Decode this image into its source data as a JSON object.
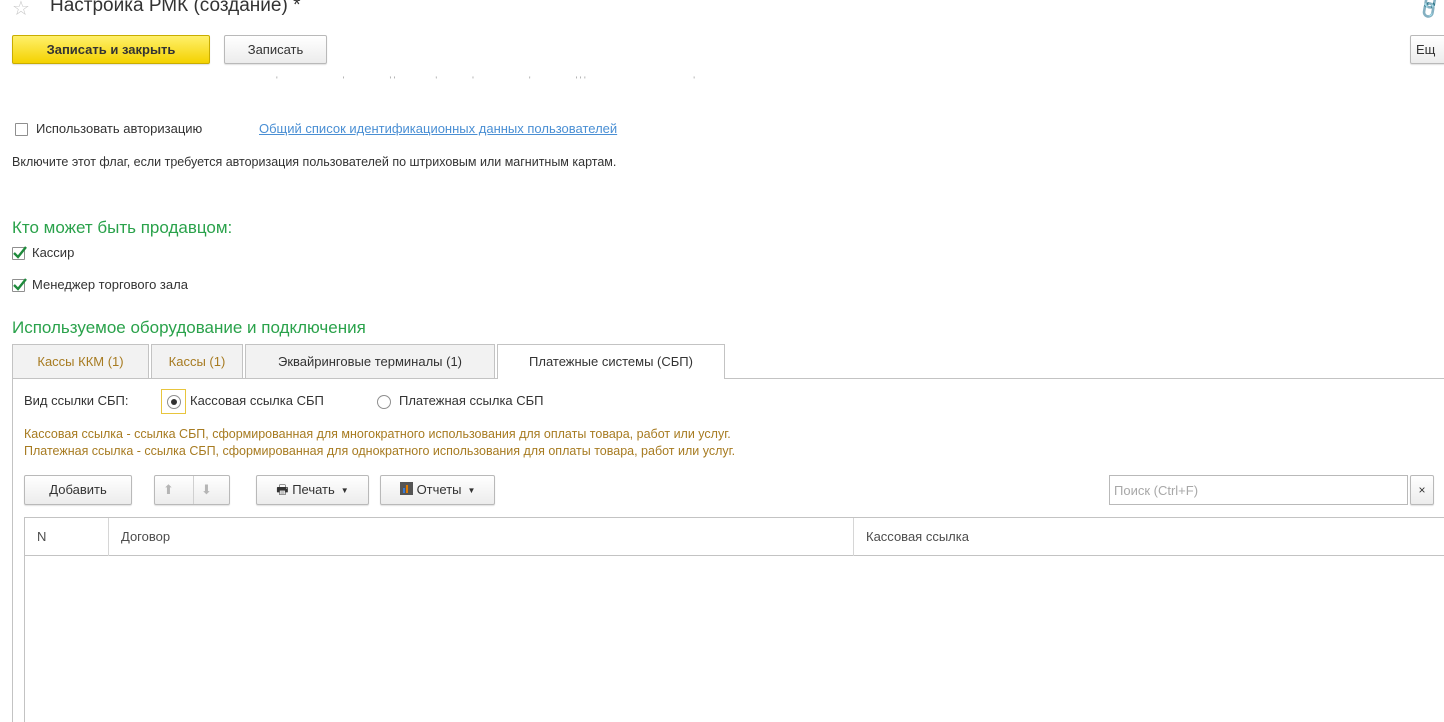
{
  "header": {
    "title": "Настройка РМК (создание) *",
    "star_icon": "☆",
    "link_icon": "🔗"
  },
  "toolbar": {
    "save_close_label": "Записать и закрыть",
    "save_label": "Записать",
    "right_button_label": "Ещ"
  },
  "authorization": {
    "checkbox_label": "Использовать авторизацию",
    "checked": false,
    "link_text": "Общий список идентификационных данных пользователей",
    "hint": "Включите этот флаг, если требуется авторизация пользователей по штриховым или магнитным картам."
  },
  "seller": {
    "heading": "Кто может быть продавцом:",
    "options": [
      {
        "label": "Кассир",
        "checked": true
      },
      {
        "label": "Менеджер торгового зала",
        "checked": true
      }
    ]
  },
  "equipment": {
    "heading": "Используемое оборудование и подключения",
    "tabs": [
      {
        "label": "Кассы ККМ (1)",
        "active": false
      },
      {
        "label": "Кассы (1)",
        "active": false
      },
      {
        "label": "Эквайринговые терминалы (1)",
        "active": false
      },
      {
        "label": "Платежные системы (СБП)",
        "active": true
      }
    ]
  },
  "sbp": {
    "link_type_label": "Вид ссылки СБП:",
    "radio_options": [
      {
        "label": "Кассовая ссылка СБП",
        "selected": true
      },
      {
        "label": "Платежная ссылка СБП",
        "selected": false
      }
    ],
    "hint_line1": "Кассовая ссылка - ссылка СБП, сформированная для многократного использования для оплаты товара, работ или услуг.",
    "hint_line2": "Платежная ссылка - ссылка СБП, сформированная для однократного использования для оплаты товара, работ или услуг."
  },
  "list_toolbar": {
    "add_label": "Добавить",
    "print_label": "Печать",
    "reports_label": "Отчеты",
    "search_placeholder": "Поиск (Ctrl+F)",
    "clear_label": "×"
  },
  "table": {
    "columns": [
      "N",
      "Договор",
      "Кассовая ссылка"
    ],
    "rows": []
  },
  "colors": {
    "accent_yellow": "#f4d200",
    "section_green": "#2aa24b",
    "hint_brown": "#a77b21",
    "link_blue": "#4a8fd4"
  }
}
